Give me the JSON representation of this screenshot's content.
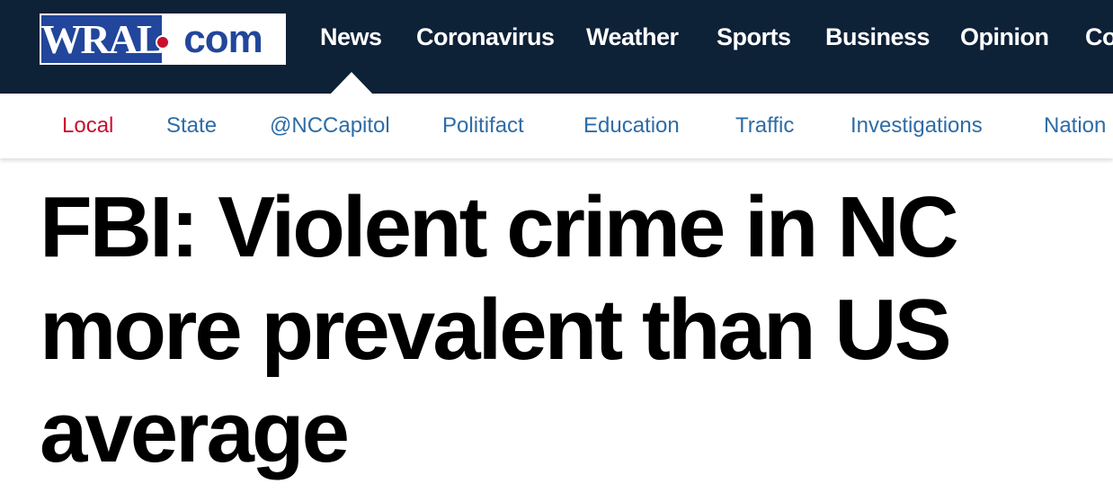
{
  "logo": {
    "part1": "WRAL",
    "part2": "com"
  },
  "main_nav": [
    "News",
    "Coronavirus",
    "Weather",
    "Sports",
    "Business",
    "Opinion",
    "Co"
  ],
  "sub_nav": [
    "Local",
    "State",
    "@NCCapitol",
    "Politifact",
    "Education",
    "Traffic",
    "Investigations",
    "Nation"
  ],
  "article": {
    "headline": "FBI: Violent crime in NC more prevalent than US average"
  },
  "colors": {
    "topbar": "#0d2137",
    "logo_blue": "#21469b",
    "accent_red": "#c8102e",
    "link_blue": "#2e6ca6"
  }
}
